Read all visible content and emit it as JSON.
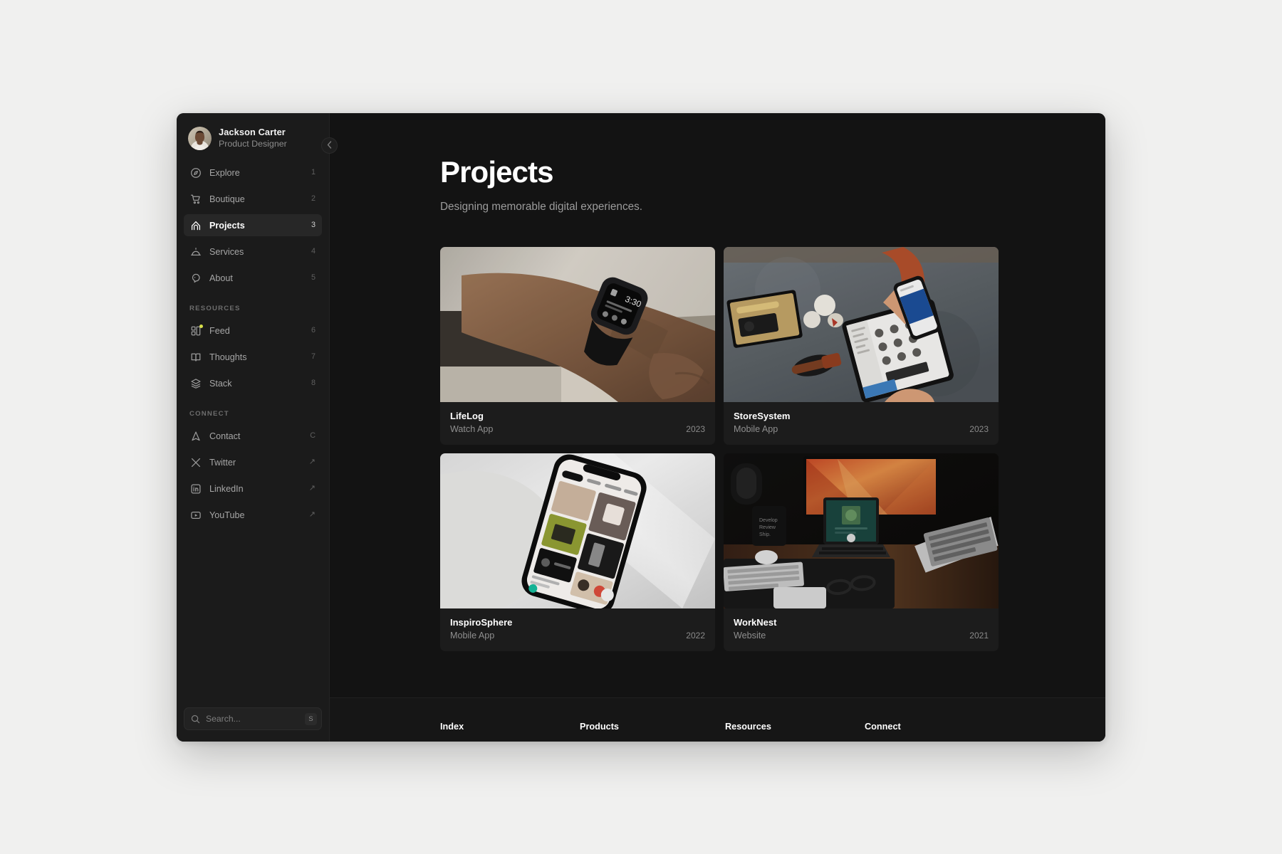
{
  "profile": {
    "name": "Jackson Carter",
    "role": "Product Designer",
    "avatar_icon": "user-avatar-photo"
  },
  "sidebar": {
    "collapse_icon": "chevron-left-icon",
    "main_nav": [
      {
        "label": "Explore",
        "key": "1",
        "icon": "compass-icon",
        "active": false,
        "badge": false
      },
      {
        "label": "Boutique",
        "key": "2",
        "icon": "cart-icon",
        "active": false,
        "badge": false
      },
      {
        "label": "Projects",
        "key": "3",
        "icon": "arch-icon",
        "active": true,
        "badge": false
      },
      {
        "label": "Services",
        "key": "4",
        "icon": "bell-dome-icon",
        "active": false,
        "badge": false
      },
      {
        "label": "About",
        "key": "5",
        "icon": "speech-icon",
        "active": false,
        "badge": false
      }
    ],
    "resources_label": "RESOURCES",
    "resources_nav": [
      {
        "label": "Feed",
        "key": "6",
        "icon": "layout-grid-icon",
        "active": false,
        "badge": true
      },
      {
        "label": "Thoughts",
        "key": "7",
        "icon": "book-open-icon",
        "active": false,
        "badge": false
      },
      {
        "label": "Stack",
        "key": "8",
        "icon": "layers-icon",
        "active": false,
        "badge": false
      }
    ],
    "connect_label": "CONNECT",
    "connect_nav": [
      {
        "label": "Contact",
        "key": "C",
        "icon": "navigation-icon",
        "external": false
      },
      {
        "label": "Twitter",
        "key": "↗",
        "icon": "x-twitter-icon",
        "external": true
      },
      {
        "label": "LinkedIn",
        "key": "↗",
        "icon": "linkedin-icon",
        "external": true
      },
      {
        "label": "YouTube",
        "key": "↗",
        "icon": "youtube-icon",
        "external": true
      }
    ],
    "search": {
      "placeholder": "Search...",
      "shortcut": "S",
      "icon": "search-icon"
    }
  },
  "main": {
    "title": "Projects",
    "subtitle": "Designing memorable digital experiences.",
    "projects": [
      {
        "title": "LifeLog",
        "category": "Watch App",
        "year": "2023",
        "image": "hand-wearing-smartwatch"
      },
      {
        "title": "StoreSystem",
        "category": "Mobile App",
        "year": "2023",
        "image": "desk-topdown-phone-tablet"
      },
      {
        "title": "InspiroSphere",
        "category": "Mobile App",
        "year": "2022",
        "image": "phone-on-laptop-moodboard"
      },
      {
        "title": "WorkNest",
        "category": "Website",
        "year": "2021",
        "image": "dark-desk-setup-monitor"
      }
    ]
  },
  "footer": {
    "columns": [
      {
        "heading": "Index"
      },
      {
        "heading": "Products"
      },
      {
        "heading": "Resources"
      },
      {
        "heading": "Connect"
      }
    ]
  },
  "colors": {
    "page_background": "#f0f0ef",
    "window_background": "#111111",
    "sidebar_background": "#1b1b1b",
    "main_background": "#131313",
    "card_background": "#1c1c1c",
    "active_item_background": "#272727",
    "footer_background": "#161616",
    "text_primary": "#ffffff",
    "text_muted": "#9c9c9c",
    "badge_dot": "#d8e04a"
  }
}
